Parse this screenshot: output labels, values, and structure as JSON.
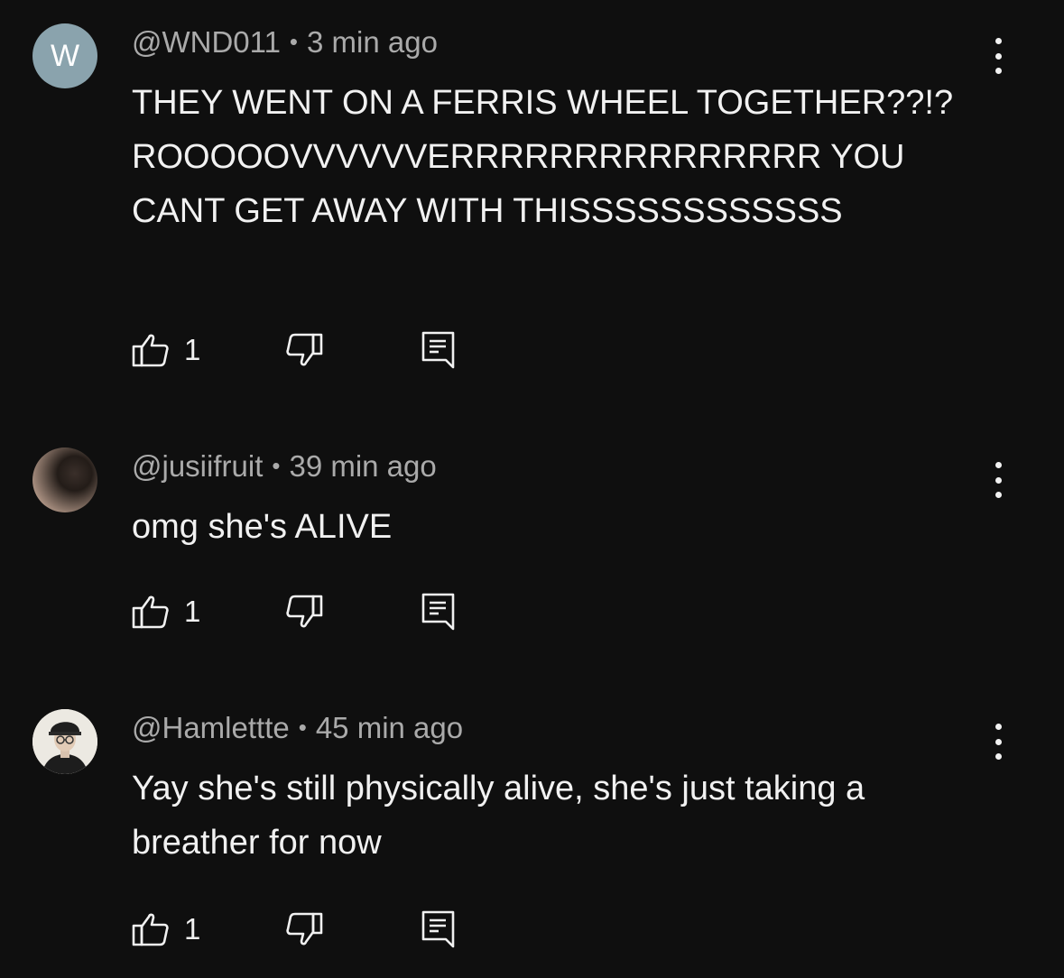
{
  "comments": [
    {
      "author": "@WND011",
      "separator": "•",
      "time": "3 min ago",
      "avatar_letter": "W",
      "text": "THEY WENT ON A FERRIS WHEEL TOGETHER??!? ROOOOOVVVVVVERRRRRRRRRRRRRRR YOU CANT GET AWAY WITH THISSSSSSSSSSSS",
      "likes": "1"
    },
    {
      "author": "@jusiifruit",
      "separator": "•",
      "time": "39 min ago",
      "text": "omg she's ALIVE",
      "likes": "1"
    },
    {
      "author": "@Hamlettte",
      "separator": "•",
      "time": "45 min ago",
      "text": "Yay she's still physically alive, she's just taking a breather for now",
      "likes": "1"
    }
  ],
  "icons": {
    "like": "thumbs-up-icon",
    "dislike": "thumbs-down-icon",
    "reply": "reply-comment-icon",
    "more": "more-vertical-icon"
  },
  "colors": {
    "background": "#0f0f0f",
    "text": "#f1f1f1",
    "meta": "#aaaaaa",
    "avatar_w": "#8aa3ad"
  }
}
